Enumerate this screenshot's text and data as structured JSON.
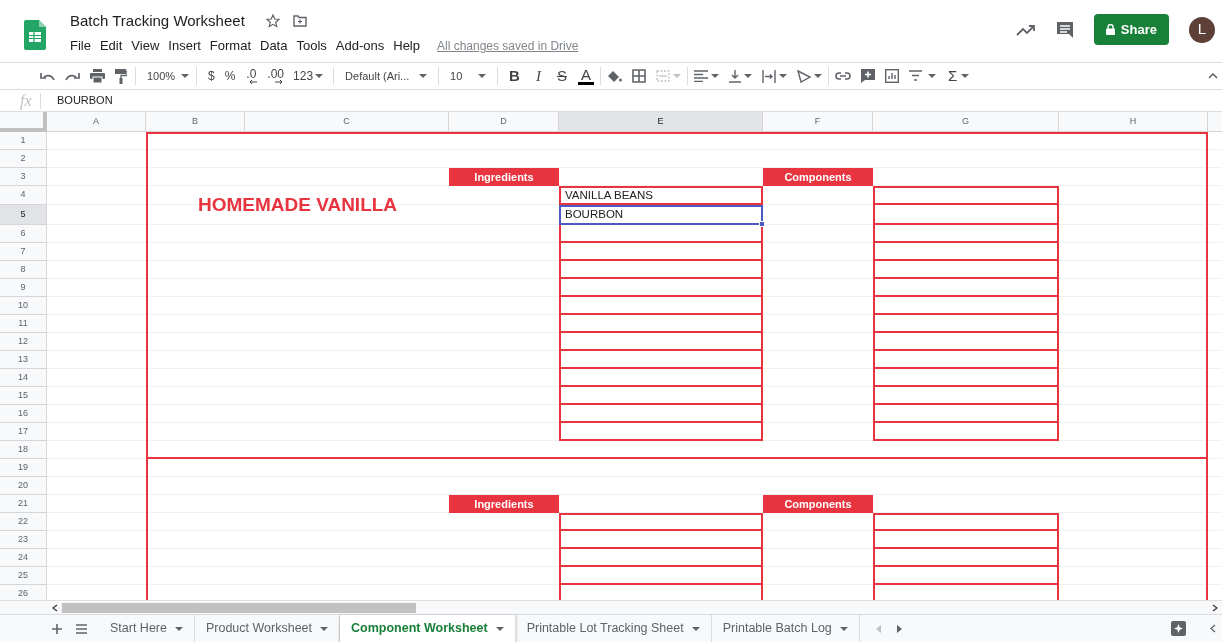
{
  "app": {
    "title": "Batch Tracking Worksheet",
    "menu": [
      "File",
      "Edit",
      "View",
      "Insert",
      "Format",
      "Data",
      "Tools",
      "Add-ons",
      "Help"
    ],
    "save_status": "All changes saved in Drive",
    "share_label": "Share",
    "avatar": "L"
  },
  "toolbar": {
    "zoom": "100%",
    "currency": "$",
    "percent": "%",
    "decimal_decrease": ".0",
    "decimal_increase": ".00",
    "number_format": "123",
    "font": "Default (Ari...",
    "font_size": "10",
    "bold": "B",
    "italic": "I",
    "strikethrough": "S",
    "text_color": "A",
    "function": "Σ"
  },
  "formula_bar": {
    "label": "fx",
    "value": "BOURBON"
  },
  "sheet": {
    "columns": [
      "A",
      "B",
      "C",
      "D",
      "E",
      "F",
      "G",
      "H"
    ],
    "rows": [
      "1",
      "2",
      "3",
      "4",
      "5",
      "6",
      "7",
      "8",
      "9",
      "10",
      "11",
      "12",
      "13",
      "14",
      "15",
      "16",
      "17",
      "18",
      "19",
      "20",
      "21",
      "22",
      "23",
      "24",
      "25",
      "26"
    ],
    "blocks": [
      {
        "title": "HOMEMADE VANILLA",
        "ingredients_header": "Ingredients",
        "components_header": "Components",
        "ingredients": [
          {
            "value": "VANILLA BEANS",
            "selected": false
          },
          {
            "value": "BOURBON",
            "selected": true
          }
        ]
      },
      {
        "ingredients_header": "Ingredients",
        "components_header": "Components"
      }
    ]
  },
  "sheet_tabs": [
    {
      "label": "Start Here",
      "selected": false
    },
    {
      "label": "Product Worksheet",
      "selected": false
    },
    {
      "label": "Component Worksheet",
      "selected": true
    },
    {
      "label": "Printable Lot Tracking Sheet",
      "selected": false
    },
    {
      "label": "Printable Batch Log",
      "selected": false
    }
  ]
}
